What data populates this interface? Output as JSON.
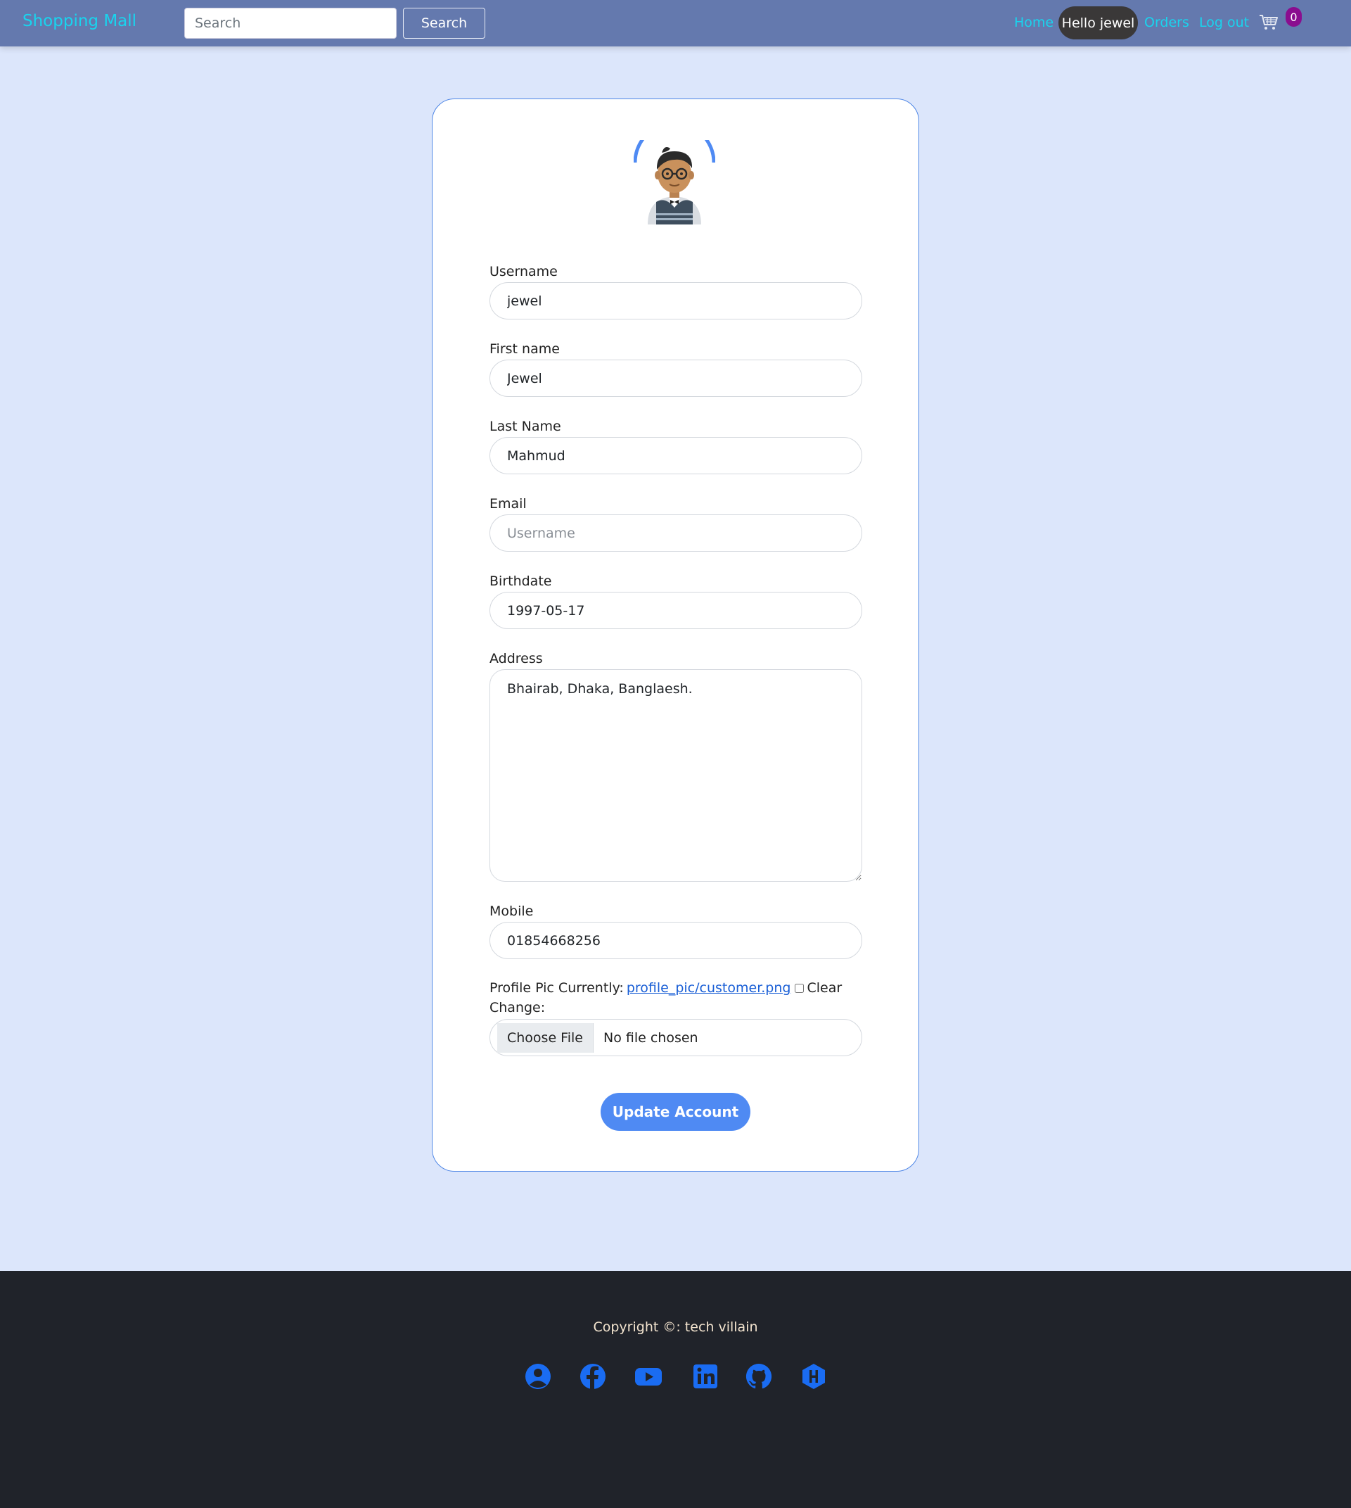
{
  "navbar": {
    "brand": "Shopping Mall",
    "search_placeholder": "Search",
    "search_button": "Search",
    "links": {
      "home": "Home",
      "hello": "Hello jewel",
      "orders": "Orders",
      "logout": "Log out"
    },
    "cart_count": "0"
  },
  "form": {
    "username": {
      "label": "Username",
      "value": "jewel"
    },
    "first_name": {
      "label": "First name",
      "value": "Jewel"
    },
    "last_name": {
      "label": "Last Name",
      "value": "Mahmud"
    },
    "email": {
      "label": "Email",
      "value": "",
      "placeholder": "Username"
    },
    "birthdate": {
      "label": "Birthdate",
      "value": "1997-05-17"
    },
    "address": {
      "label": "Address",
      "value": "Bhairab, Dhaka, Banglaesh."
    },
    "mobile": {
      "label": "Mobile",
      "value": "01854668256"
    },
    "profile_pic": {
      "currently_label": "Profile Pic Currently:",
      "current_file": "profile_pic/customer.png",
      "clear_label": "Clear",
      "change_label": "Change:",
      "choose_button": "Choose File",
      "no_file_text": "No file chosen"
    },
    "submit": "Update Account"
  },
  "footer": {
    "copyright": "Copyright ©: tech villain",
    "social_icons": [
      "user-circle-icon",
      "facebook-icon",
      "youtube-icon",
      "linkedin-icon",
      "github-icon",
      "hackerrank-icon"
    ]
  },
  "colors": {
    "navbar_bg": "#6479ae",
    "brand": "#19d4ee",
    "page_bg": "#dce6fb",
    "accent": "#4f8af3",
    "footer_bg": "#20232a",
    "social_icon": "#1a6cf2",
    "badge": "#8a0d8f"
  }
}
